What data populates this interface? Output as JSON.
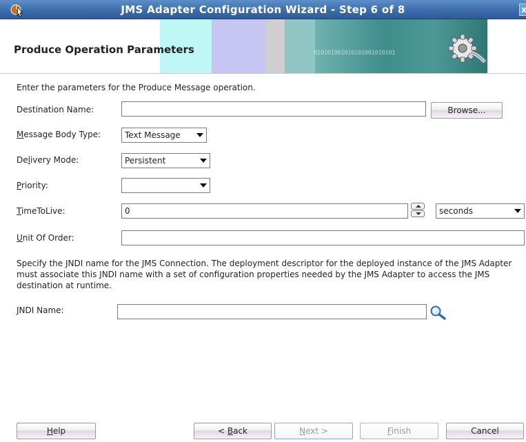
{
  "window": {
    "title": "JMS Adapter Configuration Wizard - Step 6 of 8",
    "close_glyph": "x"
  },
  "header": {
    "heading": "Produce Operation Parameters",
    "banner_bits": "010101001010101001010101"
  },
  "intro": "Enter the parameters for the Produce Message operation.",
  "form": {
    "destination_name": {
      "label": "Destination Name:",
      "value": ""
    },
    "browse_label": "Browse...",
    "message_body_type": {
      "label": "Message Body Type:",
      "mnemonic": "M",
      "rest": "essage Body Type:",
      "value": "Text Message"
    },
    "delivery_mode": {
      "label": "Delivery Mode:",
      "pre": "De",
      "mnemonic": "l",
      "rest": "ivery Mode:",
      "value": "Persistent"
    },
    "priority": {
      "label": "Priority:",
      "mnemonic": "P",
      "rest": "riority:",
      "value": ""
    },
    "time_to_live": {
      "label": "TimeToLive:",
      "mnemonic": "T",
      "rest": "imeToLive:",
      "value": "0",
      "unit": "seconds"
    },
    "unit_of_order": {
      "label": "Unit Of Order:",
      "mnemonic": "U",
      "rest": "nit Of Order:",
      "value": ""
    }
  },
  "jndi_description": "Specify the JNDI name for the JMS Connection.  The deployment descriptor for the deployed instance of the JMS Adapter must associate this JNDI name with a set of configuration properties needed by the JMS Adapter to access the JMS destination at runtime.",
  "jndi": {
    "label": "JNDI Name:",
    "mnemonic": "J",
    "rest": "NDI Name:",
    "value": "",
    "search_icon": "search-icon"
  },
  "footer": {
    "help": {
      "mnemonic": "H",
      "rest": "elp"
    },
    "back": {
      "pre": "< ",
      "mnemonic": "B",
      "rest": "ack"
    },
    "next": {
      "mnemonic": "N",
      "rest": "ext >"
    },
    "finish": {
      "mnemonic": "F",
      "rest": "inish"
    },
    "cancel": "Cancel"
  },
  "colors": {
    "title_bar": "#3a6aa8",
    "banner_cyan": "#bff6f6",
    "banner_lavender": "#c7c6f3",
    "banner_teal": "#4e9e9c"
  }
}
